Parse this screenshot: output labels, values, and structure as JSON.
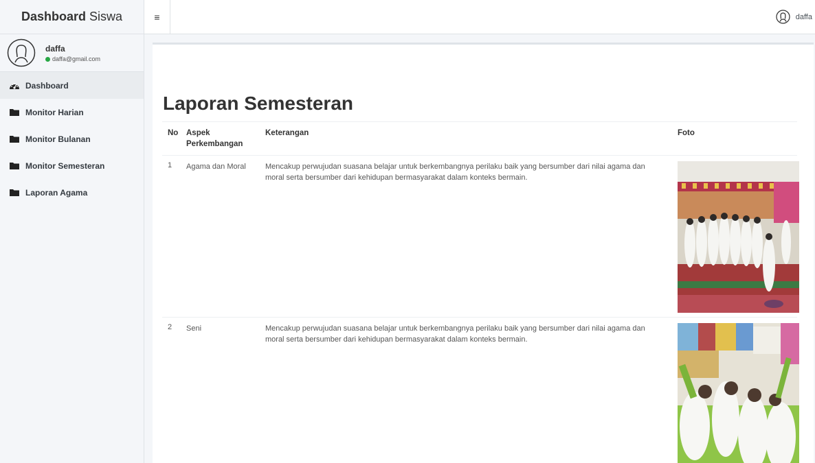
{
  "brand": {
    "bold": "Dashboard",
    "light": "Siswa"
  },
  "user": {
    "name": "daffa",
    "email": "daffa@gmail.com"
  },
  "nav": {
    "items": [
      {
        "label": "Dashboard",
        "icon": "dashboard-icon"
      },
      {
        "label": "Monitor Harian",
        "icon": "folder-icon"
      },
      {
        "label": "Monitor Bulanan",
        "icon": "folder-icon"
      },
      {
        "label": "Monitor Semesteran",
        "icon": "folder-icon"
      },
      {
        "label": "Laporan Agama",
        "icon": "folder-icon"
      }
    ]
  },
  "topbar": {
    "toggle_icon": "≡",
    "username": "daffa"
  },
  "page": {
    "title": "Laporan Semesteran"
  },
  "table": {
    "headers": {
      "no": "No",
      "aspek": "Aspek Perkembangan",
      "keterangan": "Keterangan",
      "foto": "Foto"
    },
    "rows": [
      {
        "no": "1",
        "aspek": "Agama dan Moral",
        "keterangan": "Mencakup perwujudan suasana belajar untuk berkembangnya perilaku baik yang bersumber dari nilai agama dan moral serta bersumber dari kehidupan bermasyarakat dalam konteks bermain."
      },
      {
        "no": "2",
        "aspek": "Seni",
        "keterangan": "Mencakup perwujudan suasana belajar untuk berkembangnya perilaku baik yang bersumber dari nilai agama dan moral serta bersumber dari kehidupan bermasyarakat dalam konteks bermain."
      }
    ]
  },
  "colors": {
    "status_online": "#28a745",
    "sidebar_bg": "#f4f6f9",
    "active_bg": "#e9ecef"
  }
}
